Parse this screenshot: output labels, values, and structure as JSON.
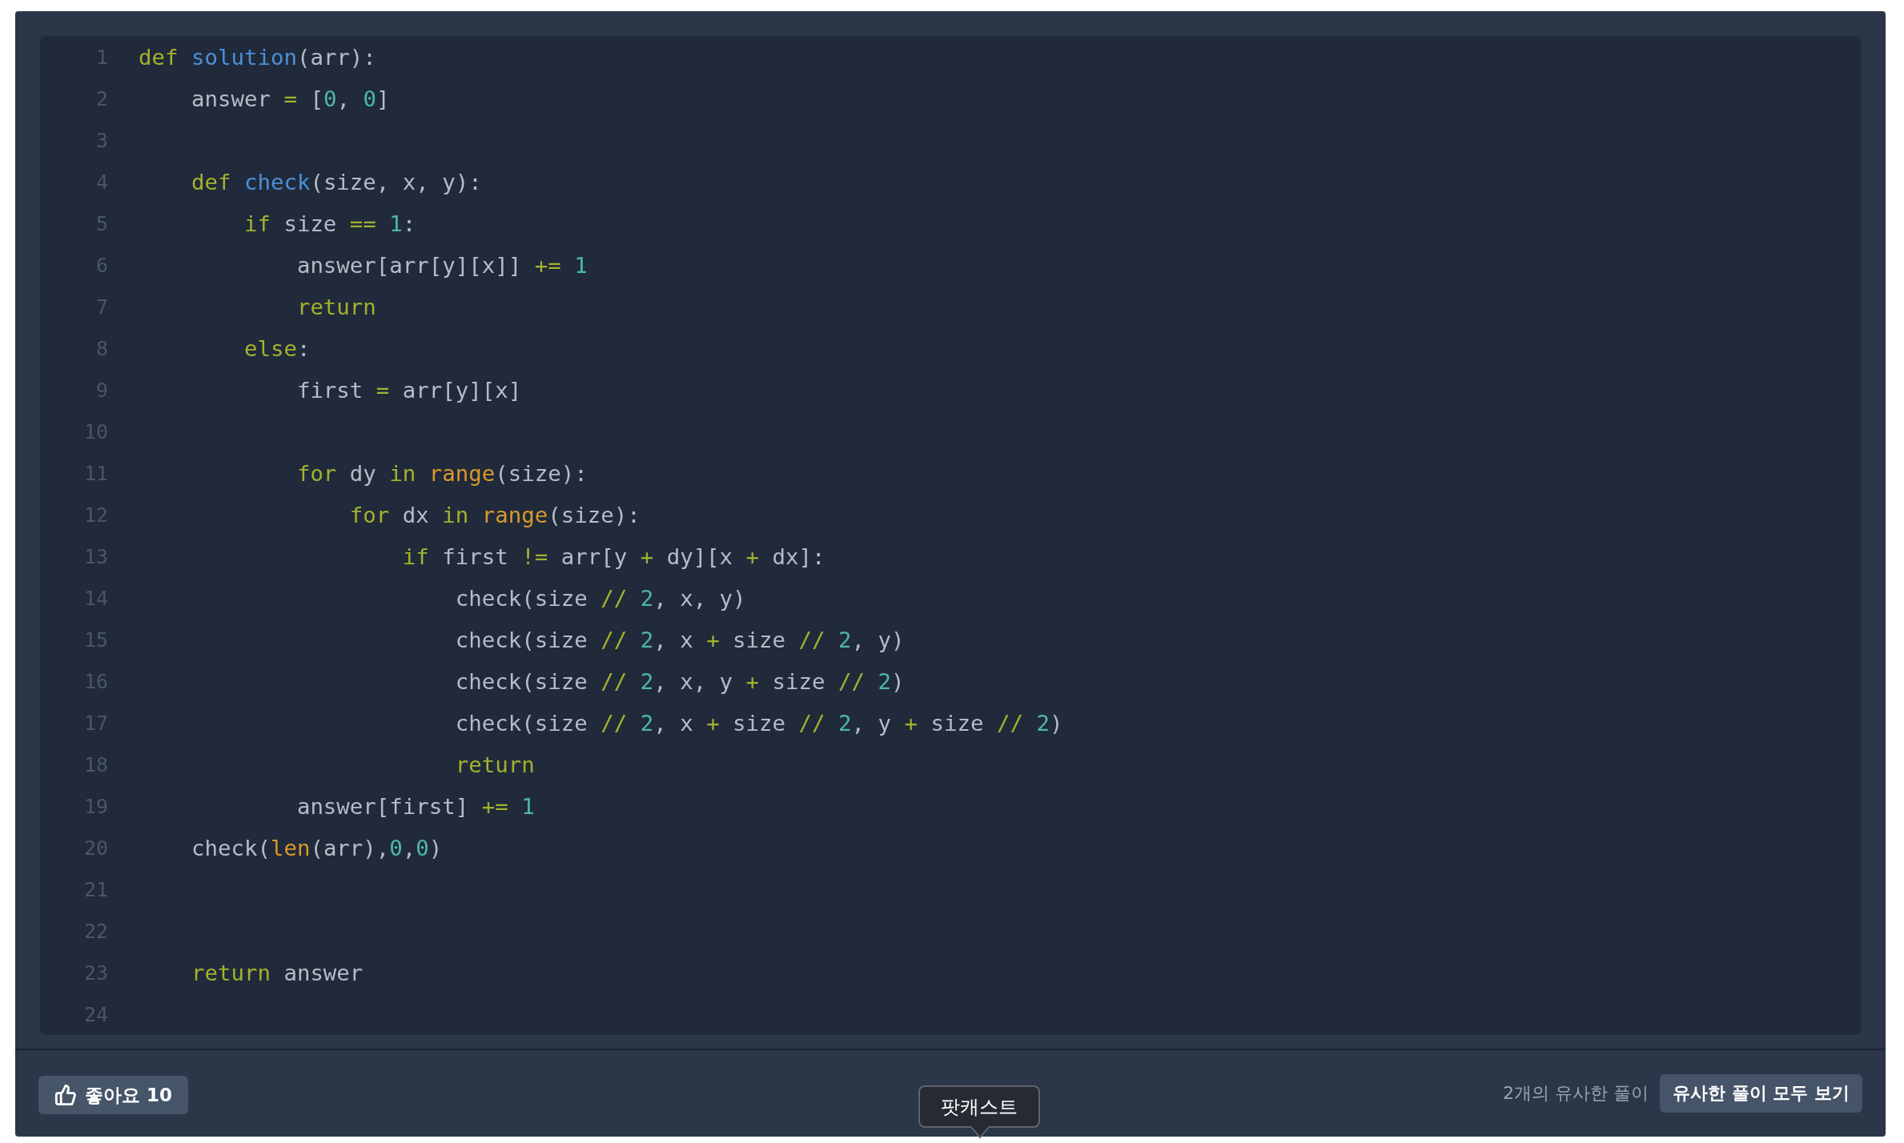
{
  "code_lines": [
    {
      "number": "1",
      "tokens": [
        {
          "kind": "keyword",
          "text": "def "
        },
        {
          "kind": "function",
          "text": "solution"
        },
        {
          "kind": "text",
          "text": "(arr):"
        }
      ]
    },
    {
      "number": "2",
      "tokens": [
        {
          "kind": "text",
          "text": "    answer "
        },
        {
          "kind": "operator",
          "text": "="
        },
        {
          "kind": "text",
          "text": " ["
        },
        {
          "kind": "number",
          "text": "0"
        },
        {
          "kind": "text",
          "text": ", "
        },
        {
          "kind": "number",
          "text": "0"
        },
        {
          "kind": "text",
          "text": "]"
        }
      ]
    },
    {
      "number": "3"
    },
    {
      "number": "4",
      "tokens": [
        {
          "kind": "keyword",
          "text": "    def "
        },
        {
          "kind": "function",
          "text": "check"
        },
        {
          "kind": "text",
          "text": "(size, x, y):"
        }
      ]
    },
    {
      "number": "5",
      "tokens": [
        {
          "kind": "keyword",
          "text": "        if"
        },
        {
          "kind": "text",
          "text": " size "
        },
        {
          "kind": "operator",
          "text": "== "
        },
        {
          "kind": "number",
          "text": "1"
        },
        {
          "kind": "text",
          "text": ":"
        }
      ]
    },
    {
      "number": "6",
      "tokens": [
        {
          "kind": "text",
          "text": "            answer[arr[y][x]] "
        },
        {
          "kind": "operator",
          "text": "+= "
        },
        {
          "kind": "number",
          "text": "1"
        }
      ]
    },
    {
      "number": "7",
      "tokens": [
        {
          "kind": "keyword",
          "text": "            return"
        }
      ]
    },
    {
      "number": "8",
      "tokens": [
        {
          "kind": "keyword",
          "text": "        else"
        },
        {
          "kind": "text",
          "text": ":"
        }
      ]
    },
    {
      "number": "9",
      "tokens": [
        {
          "kind": "text",
          "text": "            first "
        },
        {
          "kind": "operator",
          "text": "="
        },
        {
          "kind": "text",
          "text": " arr[y][x]"
        }
      ]
    },
    {
      "number": "10"
    },
    {
      "number": "11",
      "tokens": [
        {
          "kind": "keyword",
          "text": "            for"
        },
        {
          "kind": "text",
          "text": " dy "
        },
        {
          "kind": "keyword",
          "text": "in "
        },
        {
          "kind": "builtin",
          "text": "range"
        },
        {
          "kind": "text",
          "text": "(size):"
        }
      ]
    },
    {
      "number": "12",
      "tokens": [
        {
          "kind": "keyword",
          "text": "                for"
        },
        {
          "kind": "text",
          "text": " dx "
        },
        {
          "kind": "keyword",
          "text": "in "
        },
        {
          "kind": "builtin",
          "text": "range"
        },
        {
          "kind": "text",
          "text": "(size):"
        }
      ]
    },
    {
      "number": "13",
      "tokens": [
        {
          "kind": "keyword",
          "text": "                    if"
        },
        {
          "kind": "text",
          "text": " first "
        },
        {
          "kind": "operator",
          "text": "!="
        },
        {
          "kind": "text",
          "text": " arr[y "
        },
        {
          "kind": "operator",
          "text": "+"
        },
        {
          "kind": "text",
          "text": " dy][x "
        },
        {
          "kind": "operator",
          "text": "+"
        },
        {
          "kind": "text",
          "text": " dx]:"
        }
      ]
    },
    {
      "number": "14",
      "tokens": [
        {
          "kind": "text",
          "text": "                        check(size "
        },
        {
          "kind": "operator",
          "text": "// "
        },
        {
          "kind": "number",
          "text": "2"
        },
        {
          "kind": "text",
          "text": ", x, y)"
        }
      ]
    },
    {
      "number": "15",
      "tokens": [
        {
          "kind": "text",
          "text": "                        check(size "
        },
        {
          "kind": "operator",
          "text": "// "
        },
        {
          "kind": "number",
          "text": "2"
        },
        {
          "kind": "text",
          "text": ", x "
        },
        {
          "kind": "operator",
          "text": "+"
        },
        {
          "kind": "text",
          "text": " size "
        },
        {
          "kind": "operator",
          "text": "// "
        },
        {
          "kind": "number",
          "text": "2"
        },
        {
          "kind": "text",
          "text": ", y)"
        }
      ]
    },
    {
      "number": "16",
      "tokens": [
        {
          "kind": "text",
          "text": "                        check(size "
        },
        {
          "kind": "operator",
          "text": "// "
        },
        {
          "kind": "number",
          "text": "2"
        },
        {
          "kind": "text",
          "text": ", x, y "
        },
        {
          "kind": "operator",
          "text": "+"
        },
        {
          "kind": "text",
          "text": " size "
        },
        {
          "kind": "operator",
          "text": "// "
        },
        {
          "kind": "number",
          "text": "2"
        },
        {
          "kind": "text",
          "text": ")"
        }
      ]
    },
    {
      "number": "17",
      "tokens": [
        {
          "kind": "text",
          "text": "                        check(size "
        },
        {
          "kind": "operator",
          "text": "// "
        },
        {
          "kind": "number",
          "text": "2"
        },
        {
          "kind": "text",
          "text": ", x "
        },
        {
          "kind": "operator",
          "text": "+"
        },
        {
          "kind": "text",
          "text": " size "
        },
        {
          "kind": "operator",
          "text": "// "
        },
        {
          "kind": "number",
          "text": "2"
        },
        {
          "kind": "text",
          "text": ", y "
        },
        {
          "kind": "operator",
          "text": "+"
        },
        {
          "kind": "text",
          "text": " size "
        },
        {
          "kind": "operator",
          "text": "// "
        },
        {
          "kind": "number",
          "text": "2"
        },
        {
          "kind": "text",
          "text": ")"
        }
      ]
    },
    {
      "number": "18",
      "tokens": [
        {
          "kind": "keyword",
          "text": "                        return"
        }
      ]
    },
    {
      "number": "19",
      "tokens": [
        {
          "kind": "text",
          "text": "            answer[first] "
        },
        {
          "kind": "operator",
          "text": "+= "
        },
        {
          "kind": "number",
          "text": "1"
        }
      ]
    },
    {
      "number": "20",
      "tokens": [
        {
          "kind": "text",
          "text": "    check("
        },
        {
          "kind": "builtin",
          "text": "len"
        },
        {
          "kind": "text",
          "text": "(arr),"
        },
        {
          "kind": "number",
          "text": "0"
        },
        {
          "kind": "text",
          "text": ","
        },
        {
          "kind": "number",
          "text": "0"
        },
        {
          "kind": "text",
          "text": ")"
        }
      ]
    },
    {
      "number": "21"
    },
    {
      "number": "22"
    },
    {
      "number": "23",
      "tokens": [
        {
          "kind": "keyword",
          "text": "    return"
        },
        {
          "kind": "text",
          "text": " answer"
        }
      ]
    },
    {
      "number": "24"
    }
  ],
  "footer": {
    "like_button": {
      "label": "좋아요 10"
    },
    "similar_count": "2개의 유사한 풀이",
    "similar_button": "유사한 풀이 모두 보기"
  },
  "tooltip": {
    "text": "팟캐스트"
  }
}
